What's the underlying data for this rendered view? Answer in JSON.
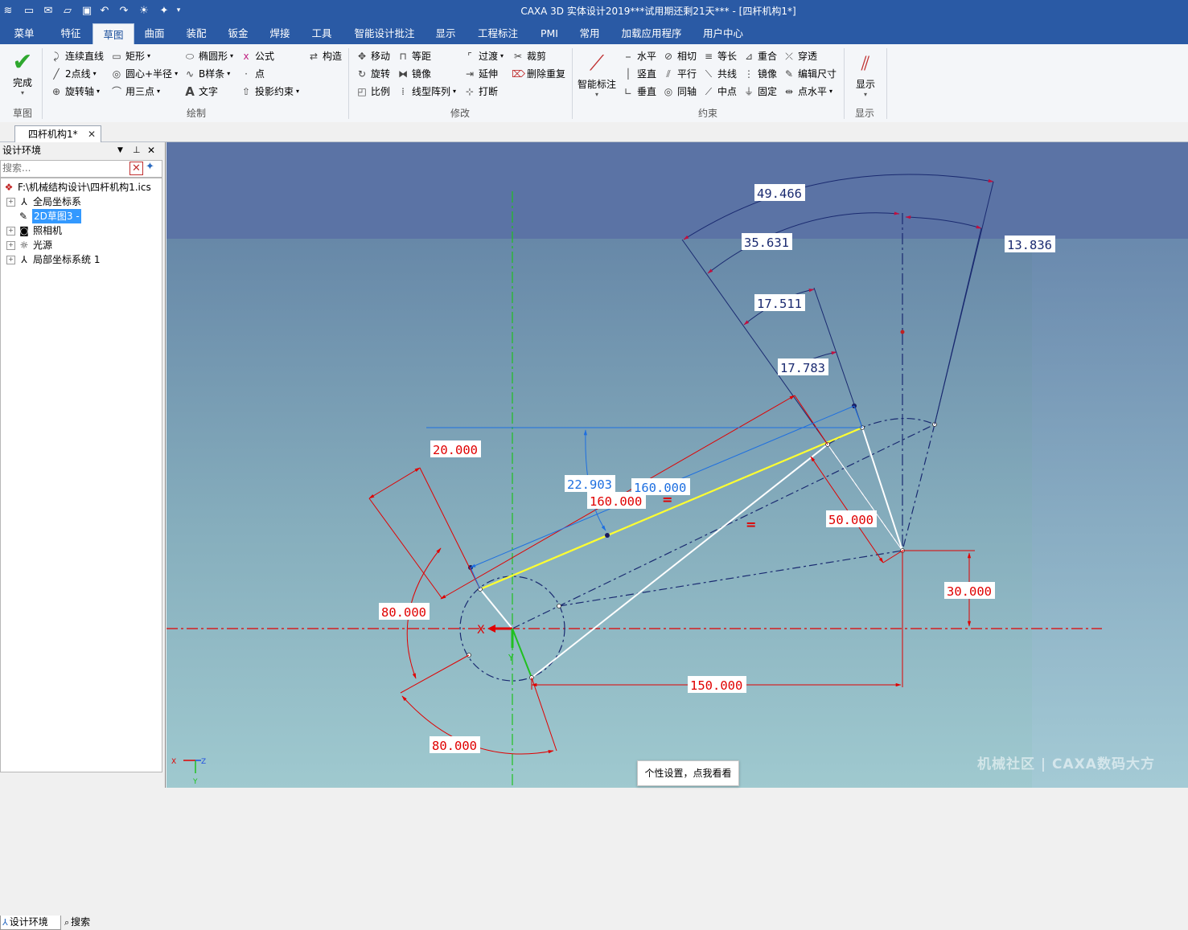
{
  "window": {
    "title": "CAXA 3D 实体设计2019***试用期还剩21天*** - [四杆机构1*]"
  },
  "menu_tabs": [
    "菜单",
    "特征",
    "草图",
    "曲面",
    "装配",
    "钣金",
    "焊接",
    "工具",
    "智能设计批注",
    "显示",
    "工程标注",
    "PMI",
    "常用",
    "加载应用程序",
    "用户中心"
  ],
  "ribbon": {
    "finish": "完成",
    "draw": [
      "连续直线",
      "矩形",
      "椭圆形",
      "公式",
      "构造",
      "2点线",
      "圆心+半径",
      "B样条",
      "点",
      "旋转轴",
      "用三点",
      "文字",
      "投影约束"
    ],
    "modify": [
      "移动",
      "等距",
      "过渡",
      "裁剪",
      "旋转",
      "镜像",
      "延伸",
      "删除重复",
      "比例",
      "线型阵列",
      "打断"
    ],
    "smart_dim": "智能标注",
    "constraints": [
      "水平",
      "相切",
      "等长",
      "重合",
      "穿透",
      "竖直",
      "平行",
      "共线",
      "镜像",
      "编辑尺寸",
      "垂直",
      "同轴",
      "中点",
      "固定",
      "点水平"
    ],
    "display": "显示",
    "groups": [
      "草图",
      "绘制",
      "修改",
      "约束",
      "显示"
    ]
  },
  "doc_tab": "四杆机构1*",
  "panel": {
    "title": "设计环境",
    "search_placeholder": "搜索...",
    "tree": [
      "F:\\机械结构设计\\四杆机构1.ics",
      "全局坐标系",
      "2D草图3 -",
      "照相机",
      "光源",
      "局部坐标系统 1"
    ],
    "bottom_tabs": [
      "设计环境",
      "搜索"
    ]
  },
  "dimensions": {
    "d1": "49.466",
    "d2": "35.631",
    "d3": "13.836",
    "d4": "17.511",
    "d5": "17.783",
    "d6": "20.000",
    "d7": "22.903",
    "d8": "160.000",
    "d9": "160.000",
    "d10": "50.000",
    "d11": "30.000",
    "d12": "80.000",
    "d13": "150.000",
    "d14": "80.000"
  },
  "constraint_marks": {
    "equal": "="
  },
  "axis": {
    "x": "X",
    "y": "Y"
  },
  "triad": {
    "x": "X",
    "z": "Z",
    "y": "Y"
  },
  "toast": "个性设置，点我看看",
  "watermark": "机械社区 | CAXA数码大方",
  "colors": {
    "title_bar": "#2a5aa5",
    "dim_red": "#e00000",
    "dim_navy": "#1a2a70",
    "dim_blue": "#1e6fe0",
    "link_yellow": "#ffff30"
  }
}
